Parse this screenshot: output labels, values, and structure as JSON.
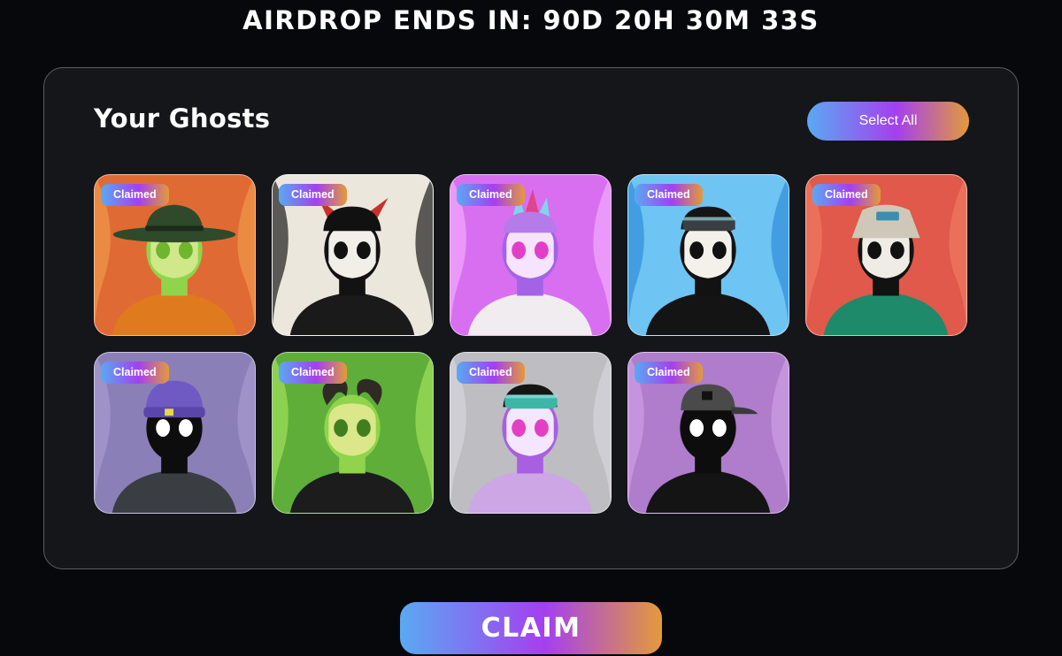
{
  "header": {
    "countdown_label": "AIRDROP ENDS IN: 90D 20H 30M 33S"
  },
  "panel": {
    "title": "Your Ghosts",
    "select_all_label": "Select All"
  },
  "gradient": {
    "start": "#5aa9f2",
    "mid": "#a43ff0",
    "end": "#e39a3a"
  },
  "ghosts": [
    {
      "badge": "Claimed",
      "bg": "#e06a34",
      "accent": "#f09a4a",
      "skin": "#8fd44a",
      "face": "#cfe88a",
      "eye": "#6fb52f",
      "hat": "cowboy",
      "hat_color": "#2f4a2a",
      "shirt": "#e07a1e"
    },
    {
      "badge": "Claimed",
      "bg": "#ece7dc",
      "accent": "#1c1c1c",
      "skin": "#121212",
      "face": "#f2efe9",
      "eye": "#111111",
      "hat": "horns",
      "hat_color": "#c8322a",
      "shirt": "#1a1a1a"
    },
    {
      "badge": "Claimed",
      "bg": "#d86ff0",
      "accent": "#f4a9ff",
      "skin": "#a463e6",
      "face": "#f6e3ff",
      "eye": "#e23fc9",
      "hat": "spikes",
      "hat_color": "#e0448a",
      "shirt": "#f1ecef"
    },
    {
      "badge": "Claimed",
      "bg": "#6ec4f2",
      "accent": "#2f8fd8",
      "skin": "#121212",
      "face": "#f4f1ea",
      "eye": "#111111",
      "hat": "goggles",
      "hat_color": "#3a3f44",
      "shirt": "#141414"
    },
    {
      "badge": "Claimed",
      "bg": "#e0594a",
      "accent": "#f07a62",
      "skin": "#121212",
      "face": "#efece6",
      "eye": "#111111",
      "hat": "bucket",
      "hat_color": "#cfc8b8",
      "shirt": "#1f8a6a"
    },
    {
      "badge": "Claimed",
      "bg": "#8b7fb8",
      "accent": "#a79ad0",
      "skin": "#0d0d0d",
      "face": "#0d0d0d",
      "eye": "#ffffff",
      "hat": "beanie",
      "hat_color": "#6f5ac4",
      "shirt": "#3a3d42"
    },
    {
      "badge": "Claimed",
      "bg": "#5fae3a",
      "accent": "#9fe05a",
      "skin": "#8fd44a",
      "face": "#dbe78a",
      "eye": "#3f7f1f",
      "hat": "ramhorns",
      "hat_color": "#2f2a24",
      "shirt": "#1c1c1c"
    },
    {
      "badge": "Claimed",
      "bg": "#bdbdc2",
      "accent": "#d9d6dd",
      "skin": "#a85fe0",
      "face": "#f4e6ff",
      "eye": "#e33fc5",
      "hat": "goggles",
      "hat_color": "#3db6a6",
      "shirt": "#cda6e6"
    },
    {
      "badge": "Claimed",
      "bg": "#b07ccc",
      "accent": "#cf9ee6",
      "skin": "#0d0d0d",
      "face": "#0d0d0d",
      "eye": "#ffffff",
      "hat": "cap",
      "hat_color": "#4a4a4a",
      "shirt": "#141414"
    }
  ],
  "footer": {
    "claim_label": "CLAIM"
  }
}
